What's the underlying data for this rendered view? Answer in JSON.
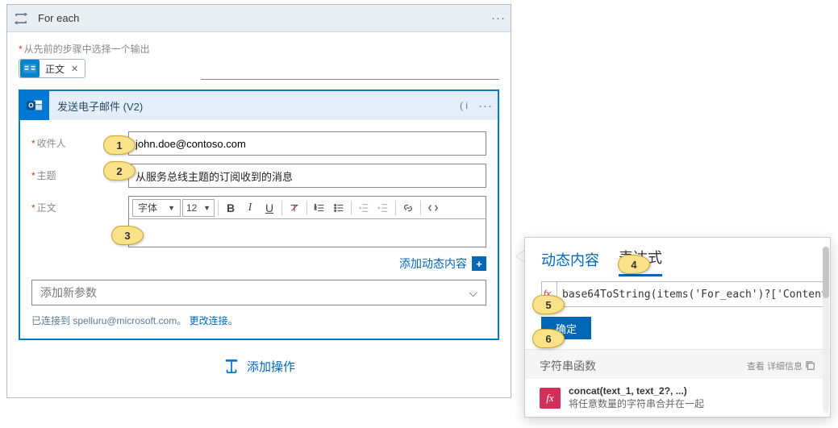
{
  "foreach": {
    "title": "For each",
    "select_label": "从先前的步骤中选择一个输出",
    "token_label": "正文"
  },
  "email": {
    "title": "发送电子邮件 (V2)",
    "fields": {
      "to_label": "收件人",
      "to_value": "john.doe@contoso.com",
      "subject_label": "主题",
      "subject_value": "从服务总线主题的订阅收到的消息",
      "body_label": "正文"
    },
    "toolbar": {
      "font_label": "字体",
      "size_label": "12"
    },
    "add_dynamic": "添加动态内容",
    "add_param": "添加新参数",
    "connection_prefix": "已连接到 ",
    "connection_account": "spelluru@microsoft.com",
    "connection_suffix": "。",
    "change_connection": "更改连接。"
  },
  "add_action": "添加操作",
  "dc": {
    "tab_dynamic": "动态内容",
    "tab_expression": "表达式",
    "expression_value": "base64ToString(items('For_each')?['Content",
    "ok": "确定",
    "section_title": "字符串函数",
    "section_more": "查看 详细信息",
    "func_sig": "concat(text_1, text_2?, ...)",
    "func_desc": "将任意数量的字符串合并在一起"
  },
  "callouts": {
    "c1": "1",
    "c2": "2",
    "c3": "3",
    "c4": "4",
    "c5": "5",
    "c6": "6"
  }
}
